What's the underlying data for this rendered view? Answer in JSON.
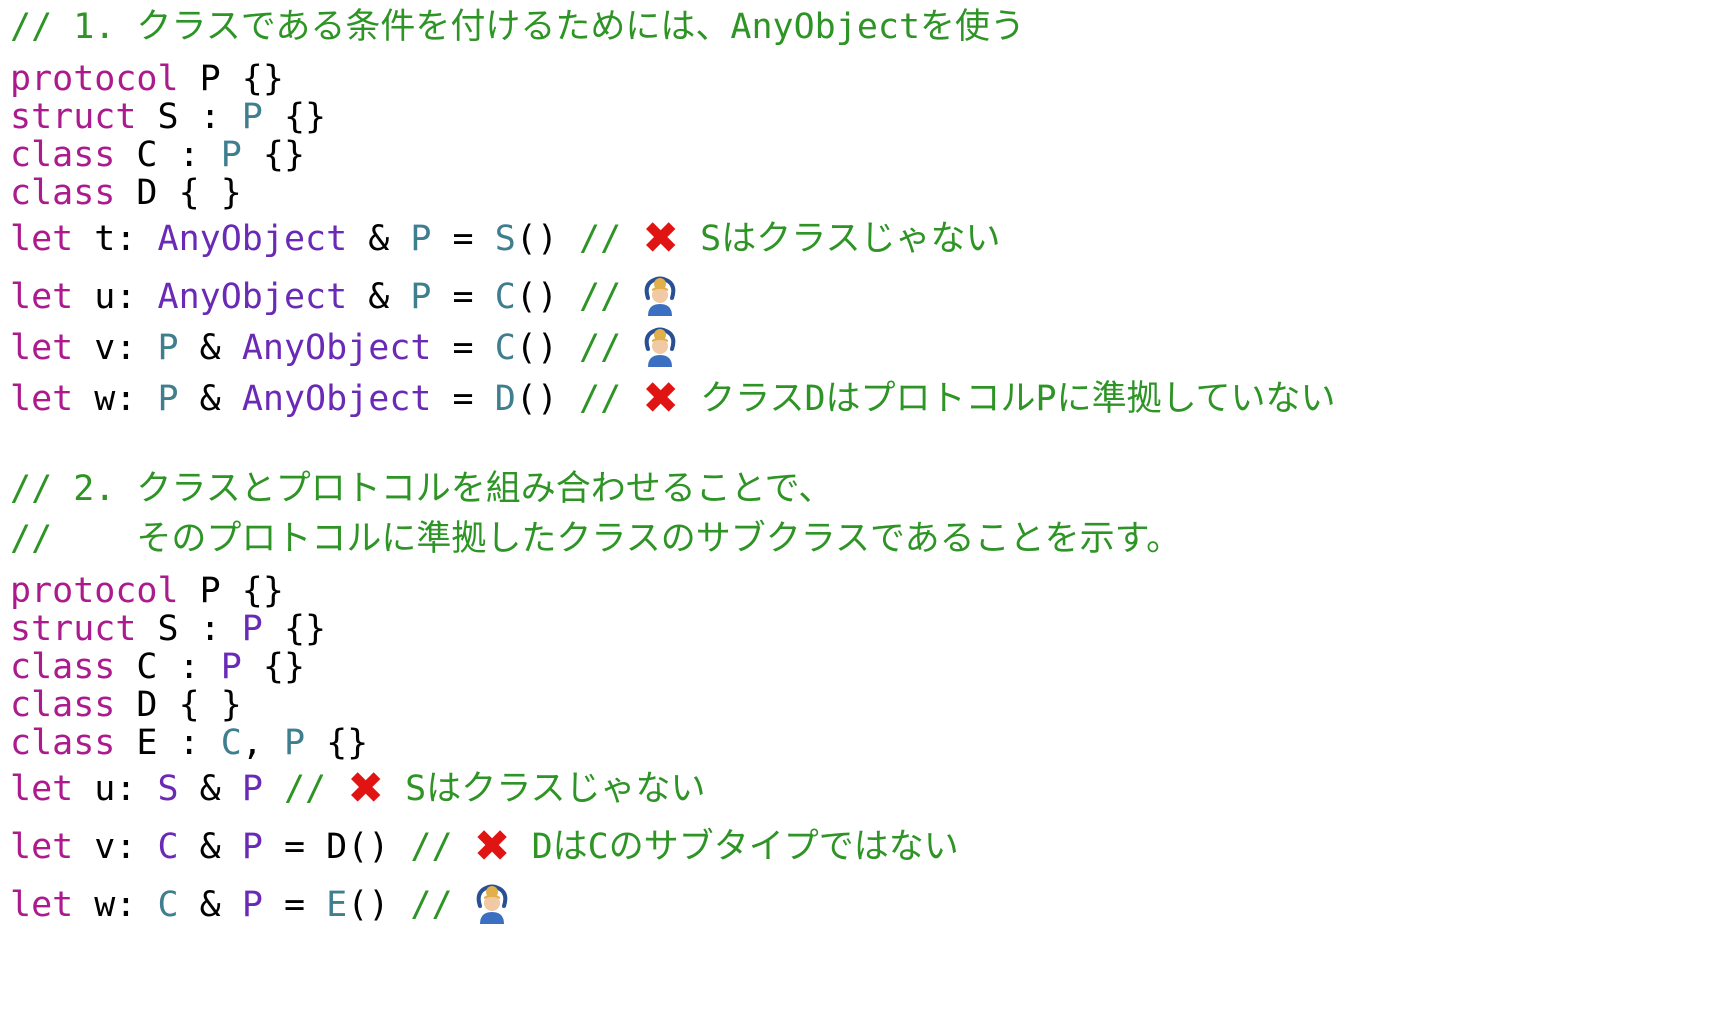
{
  "colors": {
    "background": "#ffffff",
    "comment": "#2e9425",
    "keyword": "#ac1b8e",
    "type_teal": "#3e7e8e",
    "type_purple": "#6a2ab5",
    "plain": "#000000",
    "cross_mark": "#e11414"
  },
  "icons": {
    "cross": "cross-mark-icon (❌)",
    "ok": "person-gesturing-ok-icon (🙆)"
  },
  "section1": {
    "comment": "// 1. クラスである条件を付けるためには、AnyObjectを使う",
    "lines": [
      {
        "kw": "protocol",
        "rest": " P {}"
      },
      {
        "kw": "struct",
        "a": " S : ",
        "type": "P",
        "b": " {}"
      },
      {
        "kw": "class",
        "a": " C : ",
        "type": "P",
        "b": " {}"
      },
      {
        "kw": "class",
        "a": " D { }"
      }
    ],
    "let_lines": [
      {
        "kw": "let",
        "name": " t: ",
        "t1": "AnyObject",
        "op": " & ",
        "t2": "P",
        "eq": " = ",
        "init": "S",
        "paren": "()",
        "comment": " // ",
        "note": " Sはクラスじゃない"
      },
      {
        "kw": "let",
        "name": " u: ",
        "t1": "AnyObject",
        "op": " & ",
        "t2": "P",
        "eq": " = ",
        "init": "C",
        "paren": "()",
        "comment": " // "
      },
      {
        "kw": "let",
        "name": " v: ",
        "t1": "P",
        "op": " & ",
        "t2": "AnyObject",
        "eq": " = ",
        "init": "C",
        "paren": "()",
        "comment": " // "
      },
      {
        "kw": "let",
        "name": " w: ",
        "t1": "P",
        "op": " & ",
        "t2": "AnyObject",
        "eq": " = ",
        "init": "D",
        "paren": "()",
        "comment": " // ",
        "note": " クラスDはプロトコルPに準拠していない"
      }
    ]
  },
  "section2": {
    "comment_line1": "// 2. クラスとプロトコルを組み合わせることで、",
    "comment_line2": "//    そのプロトコルに準拠したクラスのサブクラスであることを示す。",
    "lines": [
      {
        "kw": "protocol",
        "rest": " P {}"
      },
      {
        "kw": "struct",
        "a": " S : ",
        "type": "P",
        "b": " {}"
      },
      {
        "kw": "class",
        "a": " C : ",
        "type": "P",
        "b": " {}"
      },
      {
        "kw": "class",
        "a": " D { }"
      },
      {
        "kw": "class",
        "a": " E : ",
        "type": "C",
        "sep": ", ",
        "type2": "P",
        "b": " {}"
      }
    ],
    "let_lines": [
      {
        "kw": "let",
        "name": " u: ",
        "t1": "S",
        "op": " & ",
        "t2": "P",
        "comment": " // ",
        "note": " Sはクラスじゃない"
      },
      {
        "kw": "let",
        "name": " v: ",
        "t1": "C",
        "op": " & ",
        "t2": "P",
        "eq": " = ",
        "init": "D",
        "paren": "()",
        "comment": " // ",
        "note": " DはCのサブタイプではない"
      },
      {
        "kw": "let",
        "name": " w: ",
        "t1": "C",
        "op": " & ",
        "t2": "P",
        "eq": " = ",
        "init": "E",
        "paren": "()",
        "comment": " // "
      }
    ]
  }
}
